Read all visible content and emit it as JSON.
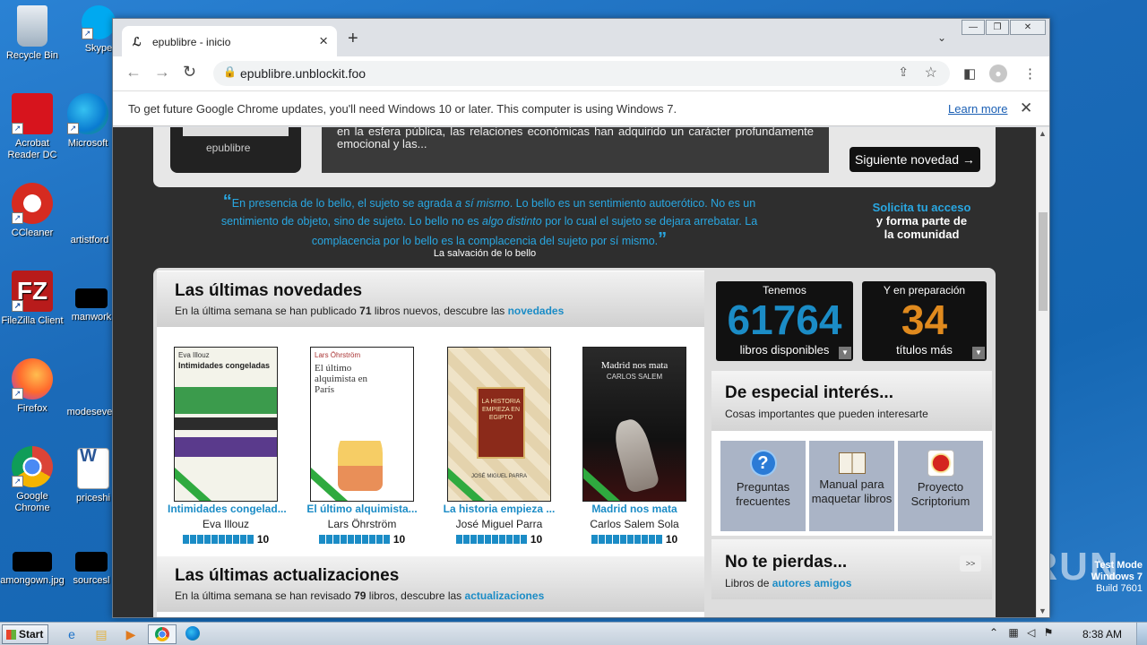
{
  "desktop": {
    "icons": [
      {
        "label": "Recycle Bin",
        "icon": "recycle-bin-icon"
      },
      {
        "label": "Skype",
        "icon": "skype-icon"
      },
      {
        "label": "Acrobat Reader DC",
        "icon": "acrobat-icon"
      },
      {
        "label": "Microsoft",
        "icon": "edge-icon"
      },
      {
        "label": "CCleaner",
        "icon": "ccleaner-icon"
      },
      {
        "label": "artistford",
        "icon": "file-icon"
      },
      {
        "label": "FileZilla Client",
        "icon": "filezilla-icon"
      },
      {
        "label": "manwork",
        "icon": "file-icon"
      },
      {
        "label": "Firefox",
        "icon": "firefox-icon"
      },
      {
        "label": "modeseve",
        "icon": "file-icon"
      },
      {
        "label": "Google Chrome",
        "icon": "chrome-icon"
      },
      {
        "label": "priceshi",
        "icon": "word-icon"
      },
      {
        "label": "amongown.jpg",
        "icon": "image-icon"
      },
      {
        "label": "sourcesl",
        "icon": "file-icon"
      }
    ],
    "watermark": {
      "line1": "Test Mode",
      "line2": "Windows 7",
      "line3": "Build 7601"
    },
    "anyrun": "ANY RUN"
  },
  "browser": {
    "tab_title": "epublibre - inicio",
    "tab_favicon": "epublibre-favicon",
    "url": "epublibre.unblockit.foo",
    "infobar_message": "To get future Google Chrome updates, you'll need Windows 10 or later. This computer is using Windows 7.",
    "infobar_link": "Learn more"
  },
  "page": {
    "ereader_logo": "epublibre",
    "excerpt": "en la esfera pública, las relaciones económicas han adquirido un carácter profundamente emocional y las...",
    "next_button": "Siguiente novedad →",
    "quote": {
      "part1": "En presencia de lo bello, el sujeto se agrada ",
      "em1": "a sí mismo",
      "part2": ". Lo bello es un sentimiento autoerótico. No es un sentimiento de objeto, sino de sujeto. Lo bello no es ",
      "em2": "algo distinto",
      "part3": " por lo cual el sujeto se dejara arrebatar. La complacencia por lo bello es la complacencia del sujeto por sí mismo.",
      "source": "La salvación de lo bello"
    },
    "solicita": {
      "line1": "Solicita tu acceso",
      "line2": "y forma parte de",
      "line3": "la comunidad"
    },
    "novedades": {
      "heading": "Las últimas novedades",
      "sub_prefix": "En la última semana se han publicado ",
      "count": "71",
      "sub_middle": " libros nuevos, descubre las ",
      "link": "novedades"
    },
    "books": [
      {
        "title": "Intimidades congelad...",
        "author": "Eva Illouz",
        "rating": 1.0,
        "rating_label": "10",
        "cover_title": "Intimidades congeladas",
        "cover_author": "Eva Illouz"
      },
      {
        "title": "El último alquimista...",
        "author": "Lars Öhrström",
        "rating": 1.0,
        "rating_label": "10",
        "cover_title": "El último alquimista en París",
        "cover_author": "Lars Öhrström"
      },
      {
        "title": "La historia empieza ...",
        "author": "José Miguel Parra",
        "rating": 1.0,
        "rating_label": "10",
        "cover_title": "LA HISTORIA EMPIEZA EN EGIPTO",
        "cover_author": "JOSÉ MIGUEL PARRA"
      },
      {
        "title": "Madrid nos mata",
        "author": "Carlos Salem Sola",
        "rating": 1.0,
        "rating_label": "10",
        "cover_title": "Madrid nos mata",
        "cover_author": "CARLOS SALEM"
      }
    ],
    "actualizaciones": {
      "heading": "Las últimas actualizaciones",
      "sub_prefix": "En la última semana se han revisado ",
      "count": "79",
      "sub_middle": " libros, descubre las ",
      "link": "actualizaciones"
    },
    "stats": [
      {
        "label": "Tenemos",
        "value": "61764",
        "foot": "libros disponibles",
        "color": "#1b8cc6"
      },
      {
        "label": "Y en preparación",
        "value": "34",
        "foot": "títulos más",
        "color": "#e08a1e"
      }
    ],
    "especial": {
      "heading": "De especial interés...",
      "sub": "Cosas importantes que pueden interesarte",
      "items": [
        {
          "label1": "Preguntas",
          "label2": "frecuentes",
          "icon": "question-icon"
        },
        {
          "label1": "Manual para",
          "label2": "maquetar libros",
          "icon": "book-icon"
        },
        {
          "label1": "Proyecto",
          "label2": "Scriptorium",
          "icon": "award-icon"
        }
      ]
    },
    "nopierdas": {
      "heading": "No te pierdas...",
      "sub_prefix": "Libros de ",
      "link": "autores amigos",
      "arrow": ">>"
    }
  },
  "taskbar": {
    "start": "Start",
    "clock": "8:38 AM"
  }
}
